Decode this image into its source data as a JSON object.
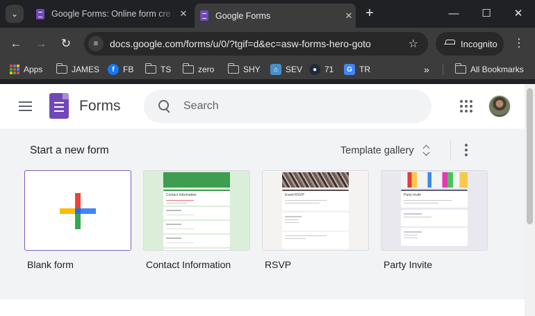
{
  "tabs": [
    {
      "title": "Google Forms: Online form cre",
      "active": false
    },
    {
      "title": "Google Forms",
      "active": true
    }
  ],
  "toolbar": {
    "url": "docs.google.com/forms/u/0/?tgif=d&ec=asw-forms-hero-goto",
    "incognito_label": "Incognito"
  },
  "bookmarks": {
    "items": [
      {
        "label": "Apps",
        "icon": "apps-grid-icon"
      },
      {
        "label": "JAMES",
        "icon": "folder-icon"
      },
      {
        "label": "FB",
        "icon": "facebook-icon"
      },
      {
        "label": "TS",
        "icon": "folder-icon"
      },
      {
        "label": "zero",
        "icon": "folder-icon"
      },
      {
        "label": "SHY",
        "icon": "folder-icon"
      },
      {
        "label": "SEV",
        "icon": "sev-icon"
      },
      {
        "label": "71",
        "icon": "site-71-icon"
      },
      {
        "label": "TR",
        "icon": "translate-icon"
      }
    ],
    "overflow": "»",
    "all_bookmarks": "All Bookmarks"
  },
  "app": {
    "title": "Forms",
    "search_placeholder": "Search"
  },
  "new_form": {
    "heading": "Start a new form",
    "gallery_label": "Template gallery",
    "templates": [
      {
        "label": "Blank form"
      },
      {
        "label": "Contact Information",
        "thumb_title": "Contact Information"
      },
      {
        "label": "RSVP",
        "thumb_title": "Event RSVP"
      },
      {
        "label": "Party Invite",
        "thumb_title": "Party Invite"
      }
    ]
  },
  "colors": {
    "forms_purple": "#7248b9",
    "contact_green": "#3e9d50",
    "plus_red": "#ea4335",
    "plus_blue": "#4285f4",
    "plus_green": "#34a853",
    "plus_yellow": "#fbbc04"
  }
}
